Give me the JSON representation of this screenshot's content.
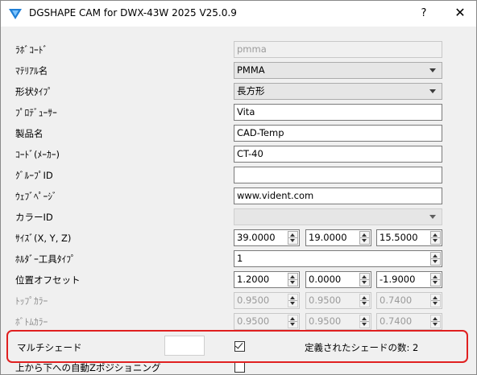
{
  "window": {
    "title": "DGSHAPE CAM for DWX-43W 2025 V25.0.9",
    "help_glyph": "?",
    "close_glyph": "✕",
    "icons": {
      "app": "dgshape-logo-icon",
      "help": "help-icon",
      "close": "close-icon"
    },
    "colors": {
      "highlight": "#e02020"
    }
  },
  "form": {
    "lab_code": {
      "label": "ﾗﾎﾞｺｰﾄﾞ",
      "value": "pmma"
    },
    "material_name": {
      "label": "ﾏﾃﾘｱﾙ名",
      "value": "PMMA"
    },
    "shape_type": {
      "label": "形状ﾀｲﾌﾟ",
      "value": "長方形"
    },
    "producer": {
      "label": "ﾌﾟﾛﾃﾞｭｰｻｰ",
      "value": "Vita"
    },
    "product_name": {
      "label": "製品名",
      "value": "CAD-Temp"
    },
    "code_maker": {
      "label": "ｺｰﾄﾞ(ﾒｰｶｰ)",
      "value": "CT-40"
    },
    "group_id": {
      "label": "ｸﾞﾙｰﾌﾟID",
      "value": ""
    },
    "webpage": {
      "label": "ｳｪﾌﾞﾍﾟｰｼﾞ",
      "value": "www.vident.com"
    },
    "color_id": {
      "label": "カラーID",
      "value": ""
    },
    "size": {
      "label": "ｻｲｽﾞ(X, Y, Z)",
      "x": "39.0000",
      "y": "19.0000",
      "z": "15.5000"
    },
    "holder_tool_type": {
      "label": "ﾎﾙﾀﾞｰ工具ﾀｲﾌﾟ",
      "value": "1"
    },
    "position_offset": {
      "label": "位置オフセット",
      "x": "1.2000",
      "y": "0.0000",
      "z": "-1.9000"
    },
    "top_color": {
      "label": "ﾄｯﾌﾟｶﾗｰ",
      "r": "0.9500",
      "g": "0.9500",
      "b": "0.7400"
    },
    "bottom_color": {
      "label": "ﾎﾞﾄﾑｶﾗｰ",
      "r": "0.9500",
      "g": "0.9500",
      "b": "0.7400"
    },
    "multi_shade": {
      "label": "マルチシェード",
      "checked": true,
      "defined_shades_text": "定義されたシェードの数: 2"
    },
    "auto_z_positioning": {
      "label": "上から下への自動Zポジショニング",
      "checked": false
    }
  }
}
